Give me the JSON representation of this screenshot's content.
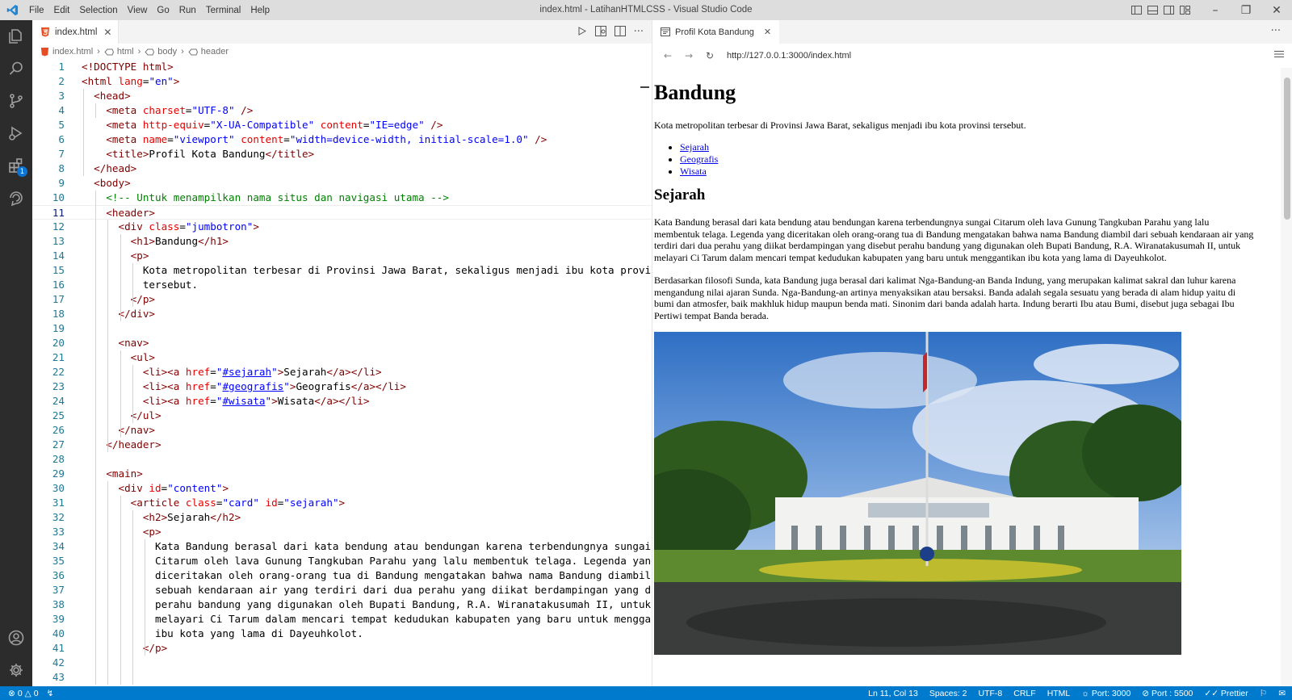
{
  "window": {
    "title": "index.html - LatihanHTMLCSS - Visual Studio Code",
    "menu": [
      "File",
      "Edit",
      "Selection",
      "View",
      "Go",
      "Run",
      "Terminal",
      "Help"
    ]
  },
  "activity_bar": {
    "items": [
      "explorer-icon",
      "search-icon",
      "source-control-icon",
      "run-debug-icon",
      "extensions-icon",
      "remote-icon"
    ],
    "extensions_badge": "1",
    "bottom": [
      "account-icon",
      "settings-gear-icon"
    ]
  },
  "editor": {
    "tab_label": "index.html",
    "breadcrumb": [
      "index.html",
      "html",
      "body",
      "header"
    ],
    "current_line": 11
  },
  "preview": {
    "tab_label": "Profil Kota Bandung",
    "url": "http://127.0.0.1:3000/index.html",
    "h1": "Bandung",
    "lead": "Kota metropolitan terbesar di Provinsi Jawa Barat, sekaligus menjadi ibu kota provinsi tersebut.",
    "nav": [
      "Sejarah",
      "Geografis",
      "Wisata"
    ],
    "h2": "Sejarah",
    "p1": "Kata Bandung berasal dari kata bendung atau bendungan karena terbendungnya sungai Citarum oleh lava Gunung Tangkuban Parahu yang lalu membentuk telaga. Legenda yang diceritakan oleh orang-orang tua di Bandung mengatakan bahwa nama Bandung diambil dari sebuah kendaraan air yang terdiri dari dua perahu yang diikat berdampingan yang disebut perahu bandung yang digunakan oleh Bupati Bandung, R.A. Wiranatakusumah II, untuk melayari Ci Tarum dalam mencari tempat kedudukan kabupaten yang baru untuk menggantikan ibu kota yang lama di Dayeuhkolot.",
    "p2": "Berdasarkan filosofi Sunda, kata Bandung juga berasal dari kalimat Nga-Bandung-an Banda Indung, yang merupakan kalimat sakral dan luhur karena mengandung nilai ajaran Sunda. Nga-Bandung-an artinya menyaksikan atau bersaksi. Banda adalah segala sesuatu yang berada di alam hidup yaitu di bumi dan atmosfer, baik makhluk hidup maupun benda mati. Sinonim dari banda adalah harta. Indung berarti Ibu atau Bumi, disebut juga sebagai Ibu Pertiwi tempat Banda berada."
  },
  "status_bar": {
    "errors": "0",
    "warnings": "0",
    "position": "Ln 11, Col 13",
    "spaces": "Spaces: 2",
    "encoding": "UTF-8",
    "eol": "CRLF",
    "language": "HTML",
    "port1": "Port: 3000",
    "port2": "Port : 5500",
    "prettier": "Prettier"
  },
  "code_lines": [
    {
      "n": "1",
      "h": [
        [
          "t",
          "<!DOCTYPE html>"
        ]
      ]
    },
    {
      "n": "2",
      "h": [
        [
          "t",
          "<html "
        ],
        [
          "a",
          "lang"
        ],
        [
          "p",
          "="
        ],
        [
          "s",
          "\"en\""
        ],
        [
          "t",
          ">"
        ]
      ]
    },
    {
      "n": "3",
      "h": [
        [
          "p",
          "  "
        ],
        [
          "t",
          "<head>"
        ]
      ]
    },
    {
      "n": "4",
      "h": [
        [
          "p",
          "    "
        ],
        [
          "t",
          "<meta "
        ],
        [
          "a",
          "charset"
        ],
        [
          "p",
          "="
        ],
        [
          "s",
          "\"UTF-8\""
        ],
        [
          "t",
          " />"
        ]
      ]
    },
    {
      "n": "5",
      "h": [
        [
          "p",
          "    "
        ],
        [
          "t",
          "<meta "
        ],
        [
          "a",
          "http-equiv"
        ],
        [
          "p",
          "="
        ],
        [
          "s",
          "\"X-UA-Compatible\""
        ],
        [
          "p",
          " "
        ],
        [
          "a",
          "content"
        ],
        [
          "p",
          "="
        ],
        [
          "s",
          "\"IE=edge\""
        ],
        [
          "t",
          " />"
        ]
      ]
    },
    {
      "n": "6",
      "h": [
        [
          "p",
          "    "
        ],
        [
          "t",
          "<meta "
        ],
        [
          "a",
          "name"
        ],
        [
          "p",
          "="
        ],
        [
          "s",
          "\"viewport\""
        ],
        [
          "p",
          " "
        ],
        [
          "a",
          "content"
        ],
        [
          "p",
          "="
        ],
        [
          "s",
          "\"width=device-width, initial-scale=1.0\""
        ],
        [
          "t",
          " />"
        ]
      ]
    },
    {
      "n": "7",
      "h": [
        [
          "p",
          "    "
        ],
        [
          "t",
          "<title>"
        ],
        [
          "p",
          "Profil Kota Bandung"
        ],
        [
          "t",
          "</title>"
        ]
      ]
    },
    {
      "n": "8",
      "h": [
        [
          "p",
          "  "
        ],
        [
          "t",
          "</head>"
        ]
      ]
    },
    {
      "n": "9",
      "h": [
        [
          "p",
          "  "
        ],
        [
          "t",
          "<body>"
        ]
      ]
    },
    {
      "n": "10",
      "h": [
        [
          "p",
          "    "
        ],
        [
          "c",
          "<!-- Untuk menampilkan nama situs dan navigasi utama -->"
        ]
      ]
    },
    {
      "n": "11",
      "h": [
        [
          "p",
          "    "
        ],
        [
          "t",
          "<header>"
        ]
      ]
    },
    {
      "n": "12",
      "h": [
        [
          "p",
          "      "
        ],
        [
          "t",
          "<div "
        ],
        [
          "a",
          "class"
        ],
        [
          "p",
          "="
        ],
        [
          "s",
          "\"jumbotron\""
        ],
        [
          "t",
          ">"
        ]
      ]
    },
    {
      "n": "13",
      "h": [
        [
          "p",
          "        "
        ],
        [
          "t",
          "<h1>"
        ],
        [
          "p",
          "Bandung"
        ],
        [
          "t",
          "</h1>"
        ]
      ]
    },
    {
      "n": "14",
      "h": [
        [
          "p",
          "        "
        ],
        [
          "t",
          "<p>"
        ]
      ]
    },
    {
      "n": "15",
      "h": [
        [
          "p",
          "          Kota metropolitan terbesar di Provinsi Jawa Barat, sekaligus menjadi ibu kota provinsi"
        ]
      ]
    },
    {
      "n": "16",
      "h": [
        [
          "p",
          "          tersebut."
        ]
      ]
    },
    {
      "n": "17",
      "h": [
        [
          "p",
          "        "
        ],
        [
          "t",
          "</p>"
        ]
      ]
    },
    {
      "n": "18",
      "h": [
        [
          "p",
          "      "
        ],
        [
          "t",
          "</div>"
        ]
      ]
    },
    {
      "n": "19",
      "h": []
    },
    {
      "n": "20",
      "h": [
        [
          "p",
          "      "
        ],
        [
          "t",
          "<nav>"
        ]
      ]
    },
    {
      "n": "21",
      "h": [
        [
          "p",
          "        "
        ],
        [
          "t",
          "<ul>"
        ]
      ]
    },
    {
      "n": "22",
      "h": [
        [
          "p",
          "          "
        ],
        [
          "t",
          "<li><a "
        ],
        [
          "a",
          "href"
        ],
        [
          "p",
          "="
        ],
        [
          "s",
          "\""
        ],
        [
          "u",
          "#sejarah"
        ],
        [
          "s",
          "\""
        ],
        [
          "t",
          ">"
        ],
        [
          "p",
          "Sejarah"
        ],
        [
          "t",
          "</a></li>"
        ]
      ]
    },
    {
      "n": "23",
      "h": [
        [
          "p",
          "          "
        ],
        [
          "t",
          "<li><a "
        ],
        [
          "a",
          "href"
        ],
        [
          "p",
          "="
        ],
        [
          "s",
          "\""
        ],
        [
          "u",
          "#geografis"
        ],
        [
          "s",
          "\""
        ],
        [
          "t",
          ">"
        ],
        [
          "p",
          "Geografis"
        ],
        [
          "t",
          "</a></li>"
        ]
      ]
    },
    {
      "n": "24",
      "h": [
        [
          "p",
          "          "
        ],
        [
          "t",
          "<li><a "
        ],
        [
          "a",
          "href"
        ],
        [
          "p",
          "="
        ],
        [
          "s",
          "\""
        ],
        [
          "u",
          "#wisata"
        ],
        [
          "s",
          "\""
        ],
        [
          "t",
          ">"
        ],
        [
          "p",
          "Wisata"
        ],
        [
          "t",
          "</a></li>"
        ]
      ]
    },
    {
      "n": "25",
      "h": [
        [
          "p",
          "        "
        ],
        [
          "t",
          "</ul>"
        ]
      ]
    },
    {
      "n": "26",
      "h": [
        [
          "p",
          "      "
        ],
        [
          "t",
          "</nav>"
        ]
      ]
    },
    {
      "n": "27",
      "h": [
        [
          "p",
          "    "
        ],
        [
          "t",
          "</header>"
        ]
      ]
    },
    {
      "n": "28",
      "h": []
    },
    {
      "n": "29",
      "h": [
        [
          "p",
          "    "
        ],
        [
          "t",
          "<main>"
        ]
      ]
    },
    {
      "n": "30",
      "h": [
        [
          "p",
          "      "
        ],
        [
          "t",
          "<div "
        ],
        [
          "a",
          "id"
        ],
        [
          "p",
          "="
        ],
        [
          "s",
          "\"content\""
        ],
        [
          "t",
          ">"
        ]
      ]
    },
    {
      "n": "31",
      "h": [
        [
          "p",
          "        "
        ],
        [
          "t",
          "<article "
        ],
        [
          "a",
          "class"
        ],
        [
          "p",
          "="
        ],
        [
          "s",
          "\"card\""
        ],
        [
          "p",
          " "
        ],
        [
          "a",
          "id"
        ],
        [
          "p",
          "="
        ],
        [
          "s",
          "\"sejarah\""
        ],
        [
          "t",
          ">"
        ]
      ]
    },
    {
      "n": "32",
      "h": [
        [
          "p",
          "          "
        ],
        [
          "t",
          "<h2>"
        ],
        [
          "p",
          "Sejarah"
        ],
        [
          "t",
          "</h2>"
        ]
      ]
    },
    {
      "n": "33",
      "h": [
        [
          "p",
          "          "
        ],
        [
          "t",
          "<p>"
        ]
      ]
    },
    {
      "n": "34",
      "h": [
        [
          "p",
          "            Kata Bandung berasal dari kata bendung atau bendungan karena terbendungnya sungai"
        ]
      ]
    },
    {
      "n": "35",
      "h": [
        [
          "p",
          "            Citarum oleh lava Gunung Tangkuban Parahu yang lalu membentuk telaga. Legenda yang"
        ]
      ]
    },
    {
      "n": "36",
      "h": [
        [
          "p",
          "            diceritakan oleh orang-orang tua di Bandung mengatakan bahwa nama Bandung diambil dari"
        ]
      ]
    },
    {
      "n": "37",
      "h": [
        [
          "p",
          "            sebuah kendaraan air yang terdiri dari dua perahu yang diikat berdampingan yang disebut"
        ]
      ]
    },
    {
      "n": "38",
      "h": [
        [
          "p",
          "            perahu bandung yang digunakan oleh Bupati Bandung, R.A. Wiranatakusumah II, untuk"
        ]
      ]
    },
    {
      "n": "39",
      "h": [
        [
          "p",
          "            melayari Ci Tarum dalam mencari tempat kedudukan kabupaten yang baru untuk menggantikan"
        ]
      ]
    },
    {
      "n": "40",
      "h": [
        [
          "p",
          "            ibu kota yang lama di Dayeuhkolot."
        ]
      ]
    },
    {
      "n": "41",
      "h": [
        [
          "p",
          "          "
        ],
        [
          "t",
          "</p>"
        ]
      ]
    },
    {
      "n": "42",
      "h": []
    },
    {
      "n": "43",
      "h": []
    }
  ]
}
